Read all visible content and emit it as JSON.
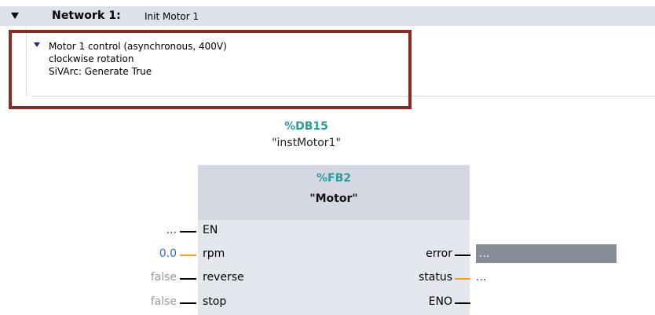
{
  "network": {
    "label": "Network 1:",
    "title": "Init Motor 1"
  },
  "comment": {
    "lines": [
      "Motor 1 control (asynchronous, 400V)",
      "clockwise rotation",
      "SiVArc: Generate True"
    ]
  },
  "instance_db": {
    "address": "%DB15",
    "name": "\"instMotor1\""
  },
  "function_block": {
    "address": "%FB2",
    "name": "\"Motor\""
  },
  "inputs": [
    {
      "pin": "EN",
      "value": "..."
    },
    {
      "pin": "rpm",
      "value": "0.0"
    },
    {
      "pin": "reverse",
      "value": "false"
    },
    {
      "pin": "stop",
      "value": "false"
    }
  ],
  "outputs": [
    {
      "pin": "error",
      "value": "..."
    },
    {
      "pin": "status",
      "value": "..."
    },
    {
      "pin": "ENO",
      "value": ""
    }
  ],
  "colors": {
    "comment_highlight": "#8c2a22",
    "address_teal": "#2b9b9b",
    "bool_wire": "#000000",
    "analog_wire": "#f5a01a",
    "constant_blue": "#2f6fc4"
  }
}
